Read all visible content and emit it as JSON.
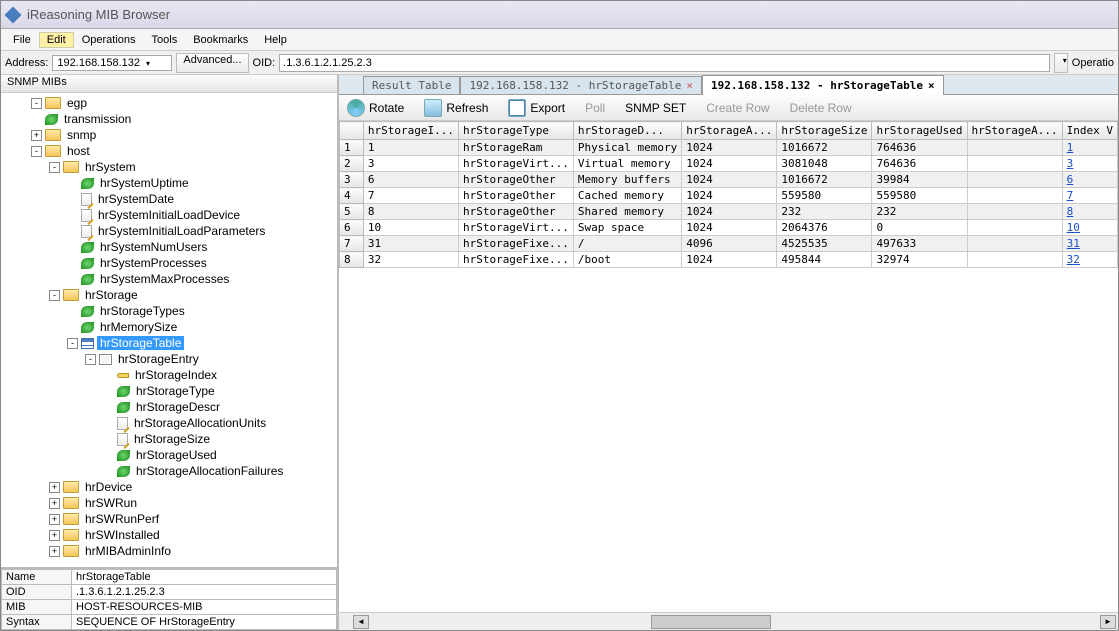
{
  "title": "iReasoning MIB Browser",
  "menu": [
    "File",
    "Edit",
    "Operations",
    "Tools",
    "Bookmarks",
    "Help"
  ],
  "menu_hl": "Edit",
  "addr_label": "Address:",
  "addr_value": "192.168.158.132",
  "advanced": "Advanced...",
  "oid_label": "OID:",
  "oid_value": ".1.3.6.1.2.1.25.2.3",
  "ops": "Operatio",
  "left_header": "SNMP MIBs",
  "tree": [
    {
      "d": 1,
      "e": "-",
      "i": "folder",
      "t": "egp"
    },
    {
      "d": 1,
      "e": "",
      "i": "leaf",
      "t": "transmission"
    },
    {
      "d": 1,
      "e": "+",
      "i": "folder",
      "t": "snmp"
    },
    {
      "d": 1,
      "e": "-",
      "i": "folder",
      "t": "host"
    },
    {
      "d": 2,
      "e": "-",
      "i": "folder",
      "t": "hrSystem"
    },
    {
      "d": 3,
      "e": "",
      "i": "leaf",
      "t": "hrSystemUptime"
    },
    {
      "d": 3,
      "e": "",
      "i": "pencil",
      "t": "hrSystemDate"
    },
    {
      "d": 3,
      "e": "",
      "i": "pencil",
      "t": "hrSystemInitialLoadDevice"
    },
    {
      "d": 3,
      "e": "",
      "i": "pencil",
      "t": "hrSystemInitialLoadParameters"
    },
    {
      "d": 3,
      "e": "",
      "i": "leaf",
      "t": "hrSystemNumUsers"
    },
    {
      "d": 3,
      "e": "",
      "i": "leaf",
      "t": "hrSystemProcesses"
    },
    {
      "d": 3,
      "e": "",
      "i": "leaf",
      "t": "hrSystemMaxProcesses"
    },
    {
      "d": 2,
      "e": "-",
      "i": "folder",
      "t": "hrStorage"
    },
    {
      "d": 3,
      "e": "",
      "i": "leaf",
      "t": "hrStorageTypes"
    },
    {
      "d": 3,
      "e": "",
      "i": "leaf",
      "t": "hrMemorySize"
    },
    {
      "d": 3,
      "e": "-",
      "i": "table",
      "t": "hrStorageTable",
      "sel": true
    },
    {
      "d": 4,
      "e": "-",
      "i": "entry",
      "t": "hrStorageEntry"
    },
    {
      "d": 5,
      "e": "",
      "i": "key",
      "t": "hrStorageIndex"
    },
    {
      "d": 5,
      "e": "",
      "i": "leaf",
      "t": "hrStorageType"
    },
    {
      "d": 5,
      "e": "",
      "i": "leaf",
      "t": "hrStorageDescr"
    },
    {
      "d": 5,
      "e": "",
      "i": "pencil",
      "t": "hrStorageAllocationUnits"
    },
    {
      "d": 5,
      "e": "",
      "i": "pencil",
      "t": "hrStorageSize"
    },
    {
      "d": 5,
      "e": "",
      "i": "leaf",
      "t": "hrStorageUsed"
    },
    {
      "d": 5,
      "e": "",
      "i": "leaf",
      "t": "hrStorageAllocationFailures"
    },
    {
      "d": 2,
      "e": "+",
      "i": "folder",
      "t": "hrDevice"
    },
    {
      "d": 2,
      "e": "+",
      "i": "folder",
      "t": "hrSWRun"
    },
    {
      "d": 2,
      "e": "+",
      "i": "folder",
      "t": "hrSWRunPerf"
    },
    {
      "d": 2,
      "e": "+",
      "i": "folder",
      "t": "hrSWInstalled"
    },
    {
      "d": 2,
      "e": "+",
      "i": "folder",
      "t": "hrMIBAdminInfo"
    }
  ],
  "details": [
    [
      "Name",
      "hrStorageTable"
    ],
    [
      "OID",
      ".1.3.6.1.2.1.25.2.3"
    ],
    [
      "MIB",
      "HOST-RESOURCES-MIB"
    ],
    [
      "Syntax",
      "SEQUENCE OF HrStorageEntry"
    ]
  ],
  "tabs": [
    {
      "label": "Result Table",
      "close": false
    },
    {
      "label": "192.168.158.132 - hrStorageTable",
      "close": true
    },
    {
      "label": "192.168.158.132 - hrStorageTable",
      "close": true,
      "active": true
    }
  ],
  "toolbar": [
    {
      "label": "Rotate",
      "icon": "rot",
      "en": true
    },
    {
      "label": "Refresh",
      "icon": "ref",
      "en": true
    },
    {
      "label": "Export",
      "icon": "exp",
      "en": true
    },
    {
      "label": "Poll",
      "icon": "",
      "en": false
    },
    {
      "label": "SNMP SET",
      "icon": "",
      "en": true
    },
    {
      "label": "Create Row",
      "icon": "",
      "en": false
    },
    {
      "label": "Delete Row",
      "icon": "",
      "en": false
    }
  ],
  "columns": [
    "hrStorageI...",
    "hrStorageType",
    "hrStorageD...",
    "hrStorageA...",
    "hrStorageSize",
    "hrStorageUsed",
    "hrStorageA...",
    "Index V"
  ],
  "rows": [
    [
      "1",
      "hrStorageRam",
      "Physical memory",
      "1024",
      "1016672",
      "764636",
      "",
      "1"
    ],
    [
      "3",
      "hrStorageVirt...",
      "Virtual memory",
      "1024",
      "3081048",
      "764636",
      "",
      "3"
    ],
    [
      "6",
      "hrStorageOther",
      "Memory buffers",
      "1024",
      "1016672",
      "39984",
      "",
      "6"
    ],
    [
      "7",
      "hrStorageOther",
      "Cached memory",
      "1024",
      "559580",
      "559580",
      "",
      "7"
    ],
    [
      "8",
      "hrStorageOther",
      "Shared memory",
      "1024",
      "232",
      "232",
      "",
      "8"
    ],
    [
      "10",
      "hrStorageVirt...",
      "Swap space",
      "1024",
      "2064376",
      "0",
      "",
      "10"
    ],
    [
      "31",
      "hrStorageFixe...",
      "/",
      "4096",
      "4525535",
      "497633",
      "",
      "31"
    ],
    [
      "32",
      "hrStorageFixe...",
      "/boot",
      "1024",
      "495844",
      "32974",
      "",
      "32"
    ]
  ]
}
